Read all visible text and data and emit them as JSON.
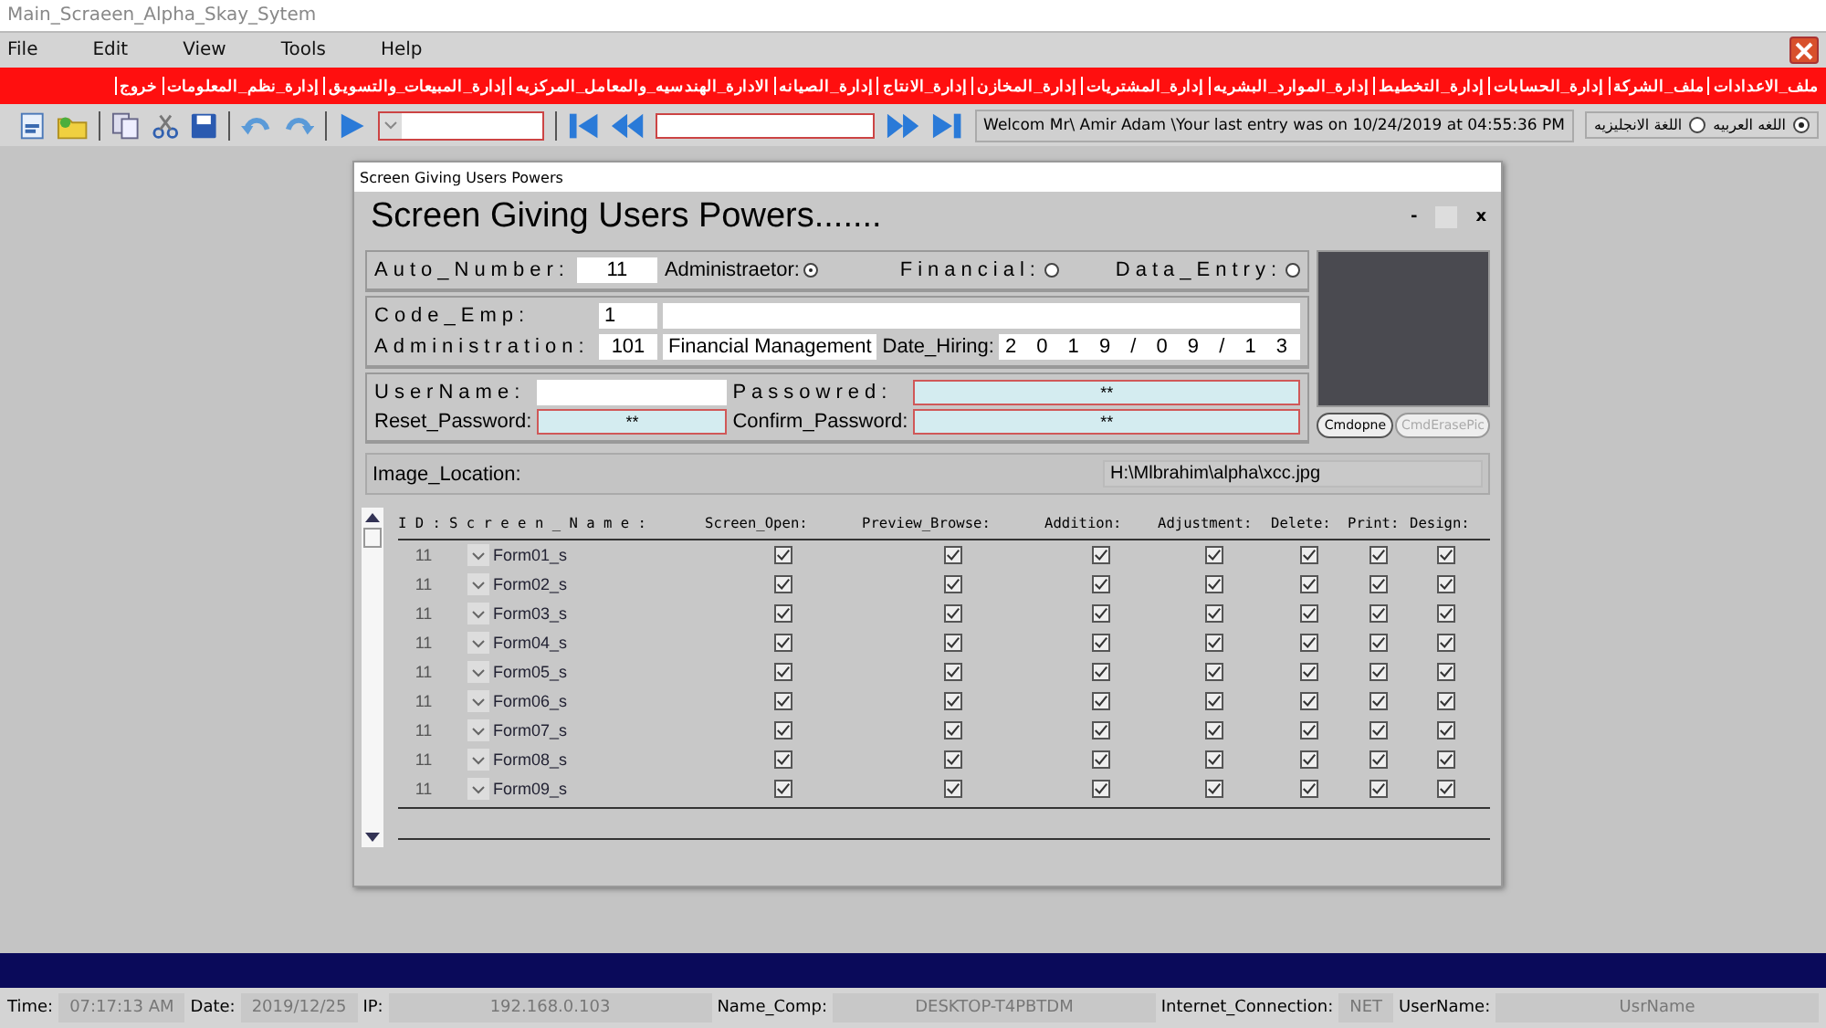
{
  "window": {
    "title": "Main_Scraeen_Alpha_Skay_Sytem"
  },
  "menu": [
    "File",
    "Edit",
    "View",
    "Tools",
    "Help"
  ],
  "module_menu": [
    "ملف_الاعدادات",
    "ملف_الشركة",
    "إدارة_الحسابات",
    "إدارة_التخطيط",
    "إدارة_الموارد_البشريه",
    "إدارة_المشتريات",
    "إدارة_المخازن",
    "إدارة_الانتاج",
    "إدارة_الصيانه",
    "الادارة_الهندسيه_والمعامل_المركزيه",
    "إدارة_المبيعات_والتسويق",
    "إدارة_نظم_المعلومات",
    "خروج"
  ],
  "welcome": "Welcom Mr\\ Amir Adam \\Your last entry was on 10/24/2019 at 04:55:36 PM",
  "languages": [
    {
      "label": "اللغه العربيه",
      "selected": true
    },
    {
      "label": "اللغة الانجليزيه",
      "selected": false
    }
  ],
  "dialog": {
    "title": "Screen Giving Users Powers",
    "heading": "Screen Giving Users Powers.......",
    "controls": [
      "-",
      "x"
    ],
    "auto_number_label": "Auto_Number:",
    "auto_number": "11",
    "roles": [
      {
        "label": "Administraetor:",
        "selected": true
      },
      {
        "label": "Financial:",
        "selected": false
      },
      {
        "label": "Data_Entry:",
        "selected": false
      }
    ],
    "code_emp_label": "Code_Emp:",
    "code_emp": "1",
    "administration_label": "Administration:",
    "administration_code": "101",
    "administration_name": "Financial Management",
    "date_hiring_label": "Date_Hiring:",
    "date_hiring": "2 0 1 9 / 0 9 / 1 3",
    "username_label": "UserName:",
    "password_label": "Passowred:",
    "password": "**",
    "reset_password_label": "Reset_Password:",
    "reset_password": "**",
    "confirm_password_label": "Confirm_Password:",
    "confirm_password": "**",
    "buttons": [
      {
        "label": "Cmdopne",
        "disabled": false
      },
      {
        "label": "CmdErasePic",
        "disabled": true
      }
    ],
    "image_location_label": "Image_Location:",
    "image_location": "H:\\Mlbrahim\\alpha\\xcc.jpg",
    "table": {
      "columns": [
        "I D :",
        "S c r e e n _ N a m e :",
        "Screen_Open:",
        "Preview_Browse:",
        "Addition:",
        "Adjustment:",
        "Delete:",
        "Print:",
        "Design:"
      ],
      "rows": [
        {
          "id": "11",
          "name": "Form01_s",
          "checks": [
            true,
            true,
            true,
            true,
            true,
            true,
            true
          ]
        },
        {
          "id": "11",
          "name": "Form02_s",
          "checks": [
            true,
            true,
            true,
            true,
            true,
            true,
            true
          ]
        },
        {
          "id": "11",
          "name": "Form03_s",
          "checks": [
            true,
            true,
            true,
            true,
            true,
            true,
            true
          ]
        },
        {
          "id": "11",
          "name": "Form04_s",
          "checks": [
            true,
            true,
            true,
            true,
            true,
            true,
            true
          ]
        },
        {
          "id": "11",
          "name": "Form05_s",
          "checks": [
            true,
            true,
            true,
            true,
            true,
            true,
            true
          ]
        },
        {
          "id": "11",
          "name": "Form06_s",
          "checks": [
            true,
            true,
            true,
            true,
            true,
            true,
            true
          ]
        },
        {
          "id": "11",
          "name": "Form07_s",
          "checks": [
            true,
            true,
            true,
            true,
            true,
            true,
            true
          ]
        },
        {
          "id": "11",
          "name": "Form08_s",
          "checks": [
            true,
            true,
            true,
            true,
            true,
            true,
            true
          ]
        },
        {
          "id": "11",
          "name": "Form09_s",
          "checks": [
            true,
            true,
            true,
            true,
            true,
            true,
            true
          ]
        }
      ]
    }
  },
  "status_bar": [
    {
      "label": "Time:",
      "value": "07:17:13 AM"
    },
    {
      "label": "Date:",
      "value": "2019/12/25"
    },
    {
      "label": "IP:",
      "value": "192.168.0.103"
    },
    {
      "label": "Name_Comp:",
      "value": "DESKTOP-T4PBTDM"
    },
    {
      "label": "Internet_Connection:",
      "value": "NET"
    },
    {
      "label": "UserName:",
      "value": "UsrName"
    }
  ]
}
